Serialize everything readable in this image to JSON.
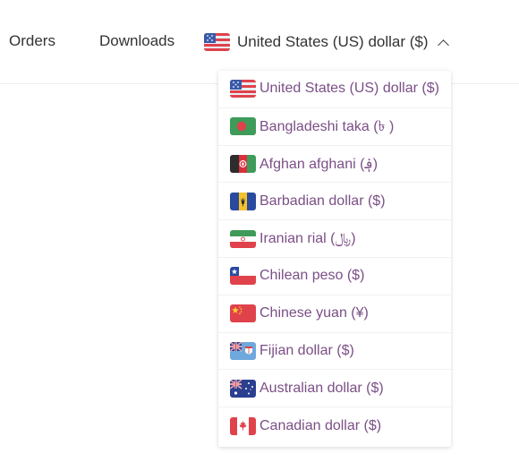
{
  "nav": {
    "orders_label": "Orders",
    "downloads_label": "Downloads"
  },
  "currency_selector": {
    "selected_label": "United States (US) dollar ($)",
    "selected_flag_icon": "us-flag-icon",
    "state": "expanded"
  },
  "currency_options": [
    {
      "label": "United States (US) dollar ($)",
      "icon": "us-flag-icon"
    },
    {
      "label": "Bangladeshi taka (৳ )",
      "icon": "bangladesh-flag-icon"
    },
    {
      "label": "Afghan afghani (؋)",
      "icon": "afghanistan-flag-icon"
    },
    {
      "label": "Barbadian dollar ($)",
      "icon": "barbados-flag-icon"
    },
    {
      "label": "Iranian rial (﷼)",
      "icon": "iran-flag-icon"
    },
    {
      "label": "Chilean peso ($)",
      "icon": "chile-flag-icon"
    },
    {
      "label": "Chinese yuan (¥)",
      "icon": "china-flag-icon"
    },
    {
      "label": "Fijian dollar ($)",
      "icon": "fiji-flag-icon"
    },
    {
      "label": "Australian dollar ($)",
      "icon": "australia-flag-icon"
    },
    {
      "label": "Canadian dollar ($)",
      "icon": "canada-flag-icon"
    }
  ],
  "colors": {
    "option_text": "#7b4f86",
    "nav_text": "#333333",
    "divider": "#ececec"
  }
}
